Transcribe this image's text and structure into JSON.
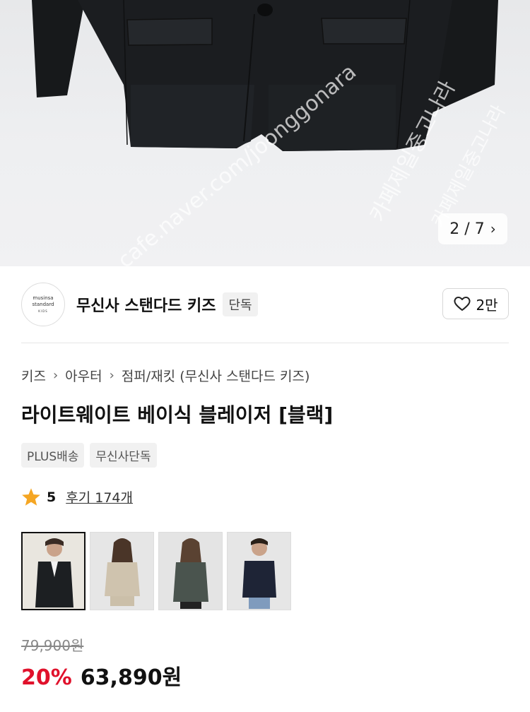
{
  "hero": {
    "counter_text": "2 / 7",
    "next_icon": "chevron-right-icon",
    "watermark_text_1": "cafe.naver.com/joonggonara",
    "watermark_text_2": "카페제일중고나라",
    "watermark_text_3": "카페제일중고나라"
  },
  "brand": {
    "logo_line1": "musinsa",
    "logo_line2": "standard",
    "logo_line3": "KIDS",
    "name": "무신사 스탠다드 키즈",
    "badge": "단독",
    "like_icon": "heart-icon",
    "like_count": "2만"
  },
  "breadcrumb": {
    "items": [
      "키즈",
      "아우터",
      "점퍼/재킷 (무신사 스탠다드 키즈)"
    ],
    "separator": "›"
  },
  "product": {
    "title": "라이트웨이트 베이식 블레이저 [블랙]",
    "tags": [
      "PLUS배송",
      "무신사단독"
    ]
  },
  "rating": {
    "icon": "star-icon",
    "star_color": "#f5a623",
    "score": "5",
    "reviews_label": "후기 174개"
  },
  "variants": [
    {
      "name": "black",
      "color": "#1c1f22",
      "selected": true
    },
    {
      "name": "beige",
      "color": "#cfc3ae",
      "selected": false
    },
    {
      "name": "gray",
      "color": "#4a544e",
      "selected": false
    },
    {
      "name": "navy",
      "color": "#1e2436",
      "selected": false
    }
  ],
  "price": {
    "original": "79,900원",
    "discount": "20%",
    "discount_color": "#e0112b",
    "current": "63,890원"
  }
}
